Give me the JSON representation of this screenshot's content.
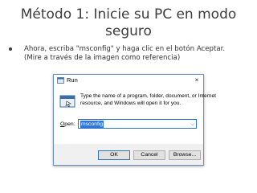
{
  "slide": {
    "title_line1": "Método 1: Inicie su PC en modo",
    "title_line2": "seguro",
    "body_line1": "Ahora, escriba \"msconfig\" y haga clic en el botón Aceptar.",
    "body_line2": "(Mire a través de la imagen como referencia)"
  },
  "run_dialog": {
    "title": "Run",
    "close_glyph": "×",
    "description_line1": "Type the name of a program, folder, document, or Internet",
    "description_line2": "resource, and Windows will open it for you.",
    "open_label_underlined": "O",
    "open_label_rest": "pen:",
    "open_value": "msconfig",
    "ok_label": "OK",
    "cancel_label": "Cancel",
    "browse_label": "Browse..."
  },
  "icons": {
    "run_small": "run-icon",
    "run_large": "run-icon",
    "dropdown": "chevron-down-icon",
    "bullet": "bullet"
  },
  "colors": {
    "title_text": "#3c3c3c",
    "selection": "#2f76d6",
    "focus_border": "#2c74c9"
  }
}
